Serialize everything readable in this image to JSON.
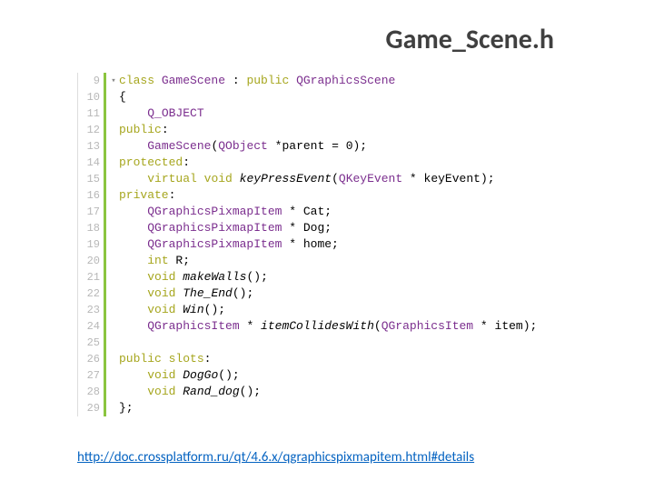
{
  "title": "Game_Scene.h",
  "lines": [
    {
      "n": "9",
      "fold": "▾",
      "tokens": [
        [
          "kw",
          "class"
        ],
        [
          "p",
          " "
        ],
        [
          "type",
          "GameScene"
        ],
        [
          "p",
          " : "
        ],
        [
          "kw",
          "public"
        ],
        [
          "p",
          " "
        ],
        [
          "type",
          "QGraphicsScene"
        ]
      ]
    },
    {
      "n": "10",
      "fold": "",
      "tokens": [
        [
          "p",
          "{"
        ]
      ]
    },
    {
      "n": "11",
      "fold": "",
      "tokens": [
        [
          "p",
          "    "
        ],
        [
          "type",
          "Q_OBJECT"
        ]
      ]
    },
    {
      "n": "12",
      "fold": "",
      "tokens": [
        [
          "kw",
          "public"
        ],
        [
          "p",
          ":"
        ]
      ]
    },
    {
      "n": "13",
      "fold": "",
      "tokens": [
        [
          "p",
          "    "
        ],
        [
          "type",
          "GameScene"
        ],
        [
          "p",
          "("
        ],
        [
          "type",
          "QObject"
        ],
        [
          "p",
          " *parent = "
        ],
        [
          "num",
          "0"
        ],
        [
          "p",
          ");"
        ]
      ]
    },
    {
      "n": "14",
      "fold": "",
      "tokens": [
        [
          "kw",
          "protected"
        ],
        [
          "p",
          ":"
        ]
      ]
    },
    {
      "n": "15",
      "fold": "",
      "tokens": [
        [
          "p",
          "    "
        ],
        [
          "kw",
          "virtual"
        ],
        [
          "p",
          " "
        ],
        [
          "kw",
          "void"
        ],
        [
          "p",
          " "
        ],
        [
          "fn",
          "keyPressEvent"
        ],
        [
          "p",
          "("
        ],
        [
          "type",
          "QKeyEvent"
        ],
        [
          "p",
          " * keyEvent);"
        ]
      ]
    },
    {
      "n": "16",
      "fold": "",
      "tokens": [
        [
          "kw",
          "private"
        ],
        [
          "p",
          ":"
        ]
      ]
    },
    {
      "n": "17",
      "fold": "",
      "tokens": [
        [
          "p",
          "    "
        ],
        [
          "type",
          "QGraphicsPixmapItem"
        ],
        [
          "p",
          " * Cat;"
        ]
      ]
    },
    {
      "n": "18",
      "fold": "",
      "tokens": [
        [
          "p",
          "    "
        ],
        [
          "type",
          "QGraphicsPixmapItem"
        ],
        [
          "p",
          " * Dog;"
        ]
      ]
    },
    {
      "n": "19",
      "fold": "",
      "tokens": [
        [
          "p",
          "    "
        ],
        [
          "type",
          "QGraphicsPixmapItem"
        ],
        [
          "p",
          " * home;"
        ]
      ]
    },
    {
      "n": "20",
      "fold": "",
      "tokens": [
        [
          "p",
          "    "
        ],
        [
          "kw",
          "int"
        ],
        [
          "p",
          " R;"
        ]
      ]
    },
    {
      "n": "21",
      "fold": "",
      "tokens": [
        [
          "p",
          "    "
        ],
        [
          "kw",
          "void"
        ],
        [
          "p",
          " "
        ],
        [
          "fn",
          "makeWalls"
        ],
        [
          "p",
          "();"
        ]
      ]
    },
    {
      "n": "22",
      "fold": "",
      "tokens": [
        [
          "p",
          "    "
        ],
        [
          "kw",
          "void"
        ],
        [
          "p",
          " "
        ],
        [
          "fn",
          "The_End"
        ],
        [
          "p",
          "();"
        ]
      ]
    },
    {
      "n": "23",
      "fold": "",
      "tokens": [
        [
          "p",
          "    "
        ],
        [
          "kw",
          "void"
        ],
        [
          "p",
          " "
        ],
        [
          "fn",
          "Win"
        ],
        [
          "p",
          "();"
        ]
      ]
    },
    {
      "n": "24",
      "fold": "",
      "tokens": [
        [
          "p",
          "    "
        ],
        [
          "type",
          "QGraphicsItem"
        ],
        [
          "p",
          " * "
        ],
        [
          "fn",
          "itemCollidesWith"
        ],
        [
          "p",
          "("
        ],
        [
          "type",
          "QGraphicsItem"
        ],
        [
          "p",
          " * item);"
        ]
      ]
    },
    {
      "n": "25",
      "fold": "",
      "tokens": []
    },
    {
      "n": "26",
      "fold": "",
      "tokens": [
        [
          "kw",
          "public"
        ],
        [
          "p",
          " "
        ],
        [
          "kw",
          "slots"
        ],
        [
          "p",
          ":"
        ]
      ]
    },
    {
      "n": "27",
      "fold": "",
      "tokens": [
        [
          "p",
          "    "
        ],
        [
          "kw",
          "void"
        ],
        [
          "p",
          " "
        ],
        [
          "fn",
          "DogGo"
        ],
        [
          "p",
          "();"
        ]
      ]
    },
    {
      "n": "28",
      "fold": "",
      "tokens": [
        [
          "p",
          "    "
        ],
        [
          "kw",
          "void"
        ],
        [
          "p",
          " "
        ],
        [
          "fn",
          "Rand_dog"
        ],
        [
          "p",
          "();"
        ]
      ]
    },
    {
      "n": "29",
      "fold": "",
      "tokens": [
        [
          "p",
          "};"
        ]
      ]
    }
  ],
  "link": "http://doc.crossplatform.ru/qt/4.6.x/qgraphicspixmapitem.html#details"
}
